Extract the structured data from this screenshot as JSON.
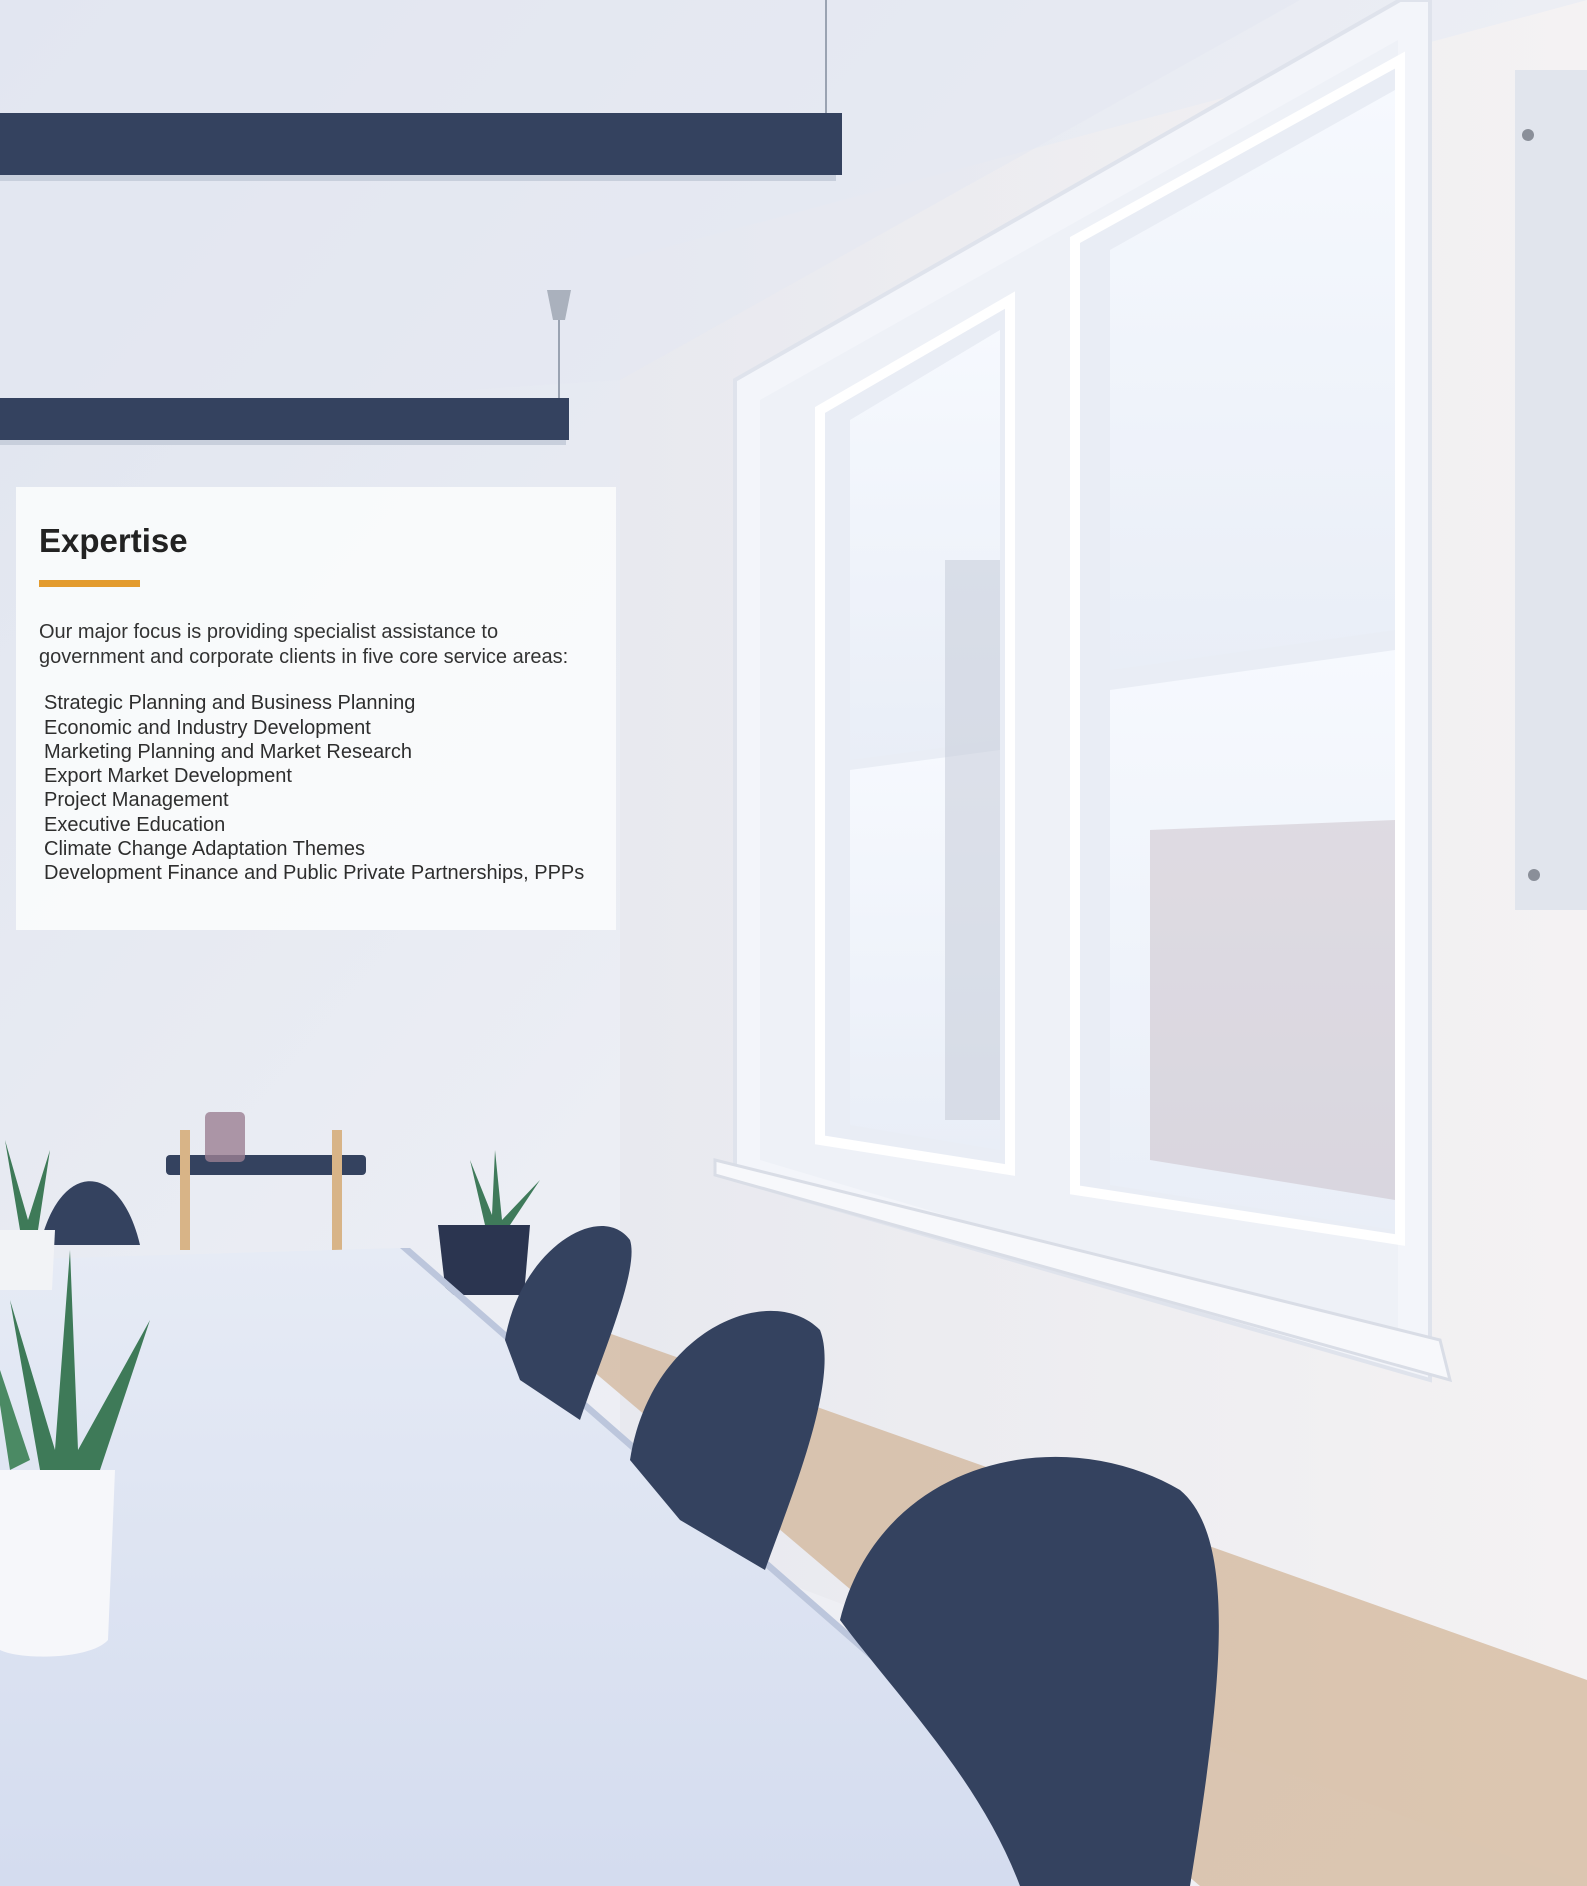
{
  "card": {
    "title": "Expertise",
    "accent_color": "#e39b2e",
    "intro": "Our major focus is providing specialist assistance to government and corporate clients in five core service areas:",
    "services": [
      "Strategic Planning and Business Planning",
      "Economic and Industry Development",
      "Marketing Planning and Market Research",
      "Export Market Development",
      "Project Management",
      "Executive Education",
      "Climate Change Adaptation Themes",
      "Development Finance and Public Private Partnerships, PPPs"
    ]
  },
  "scene": {
    "wall_color": "#e9ecf4",
    "furniture_color": "#34425f",
    "floor_color": "#c9a27a"
  }
}
